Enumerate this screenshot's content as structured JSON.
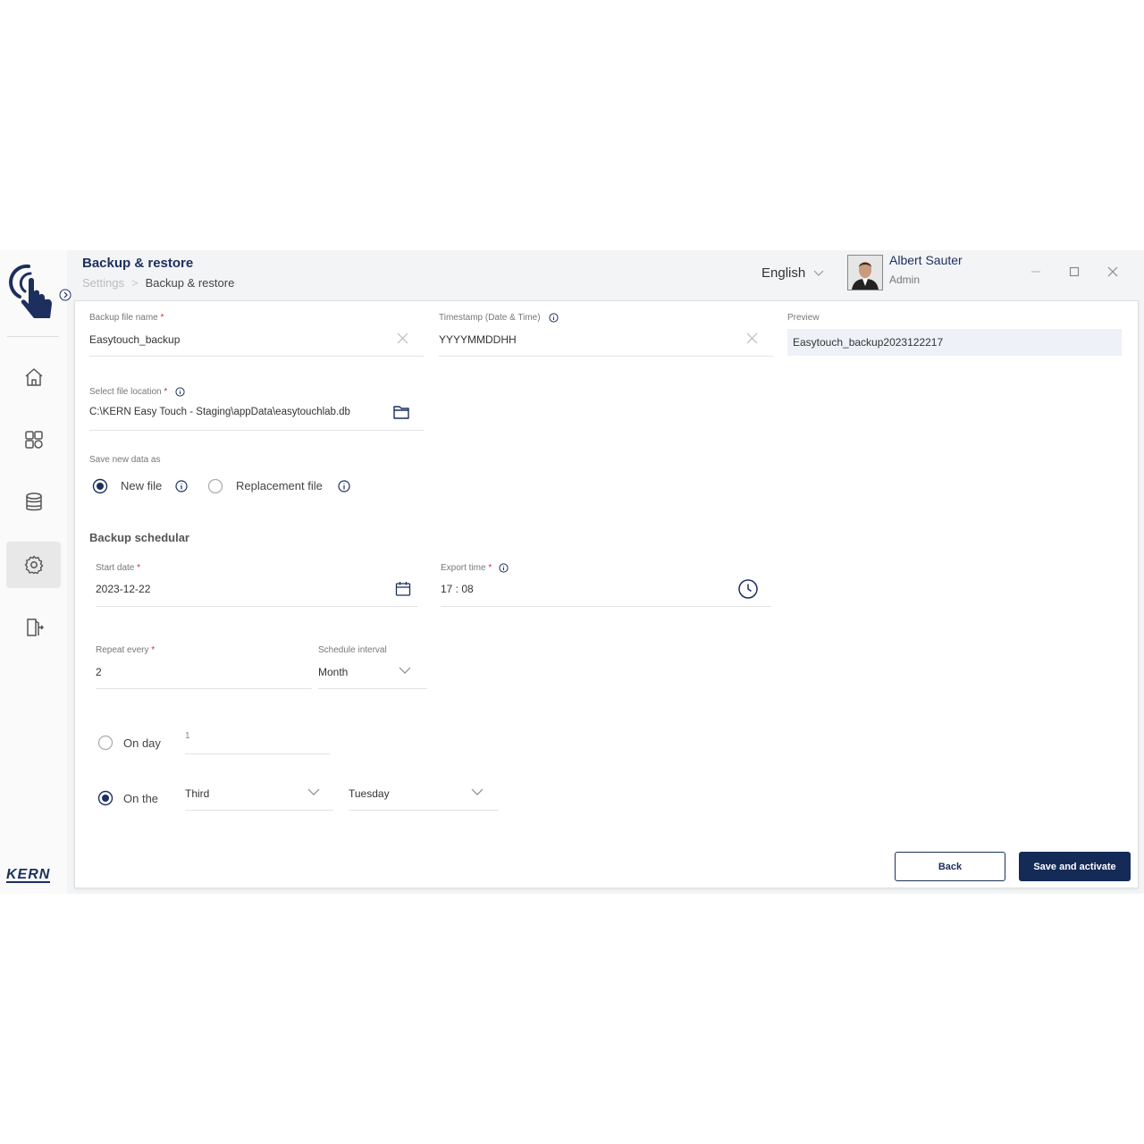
{
  "header": {
    "title": "Backup & restore",
    "breadcrumb": [
      "Settings",
      "Backup & restore"
    ],
    "language": "English",
    "user": {
      "name": "Albert Sauter",
      "role": "Admin"
    }
  },
  "brand": {
    "footer_logo": "KERN",
    "accent": "#1c2f5e"
  },
  "sidebar": {
    "items": [
      {
        "icon": "home-icon",
        "active": false
      },
      {
        "icon": "dashboard-icon",
        "active": false
      },
      {
        "icon": "database-icon",
        "active": false
      },
      {
        "icon": "gear-icon",
        "active": true
      },
      {
        "icon": "logout-icon",
        "active": false
      }
    ]
  },
  "form": {
    "backup_name": {
      "label": "Backup file name",
      "value": "Easytouch_backup"
    },
    "timestamp": {
      "label": "Timestamp (Date & Time)",
      "value": "YYYYMMDDHH"
    },
    "preview": {
      "label": "Preview",
      "value": "Easytouch_backup2023122217"
    },
    "file_location": {
      "label": "Select file location",
      "value": "C:\\KERN Easy Touch - Staging\\appData\\easytouchlab.db"
    },
    "save_as": {
      "label": "Save new data as",
      "options": [
        {
          "label": "New file",
          "selected": true
        },
        {
          "label": "Replacement file",
          "selected": false
        }
      ]
    },
    "scheduler": {
      "title": "Backup schedular",
      "start_date": {
        "label": "Start date",
        "value": "2023-12-22"
      },
      "export_time": {
        "label": "Export time",
        "value": "17 : 08"
      },
      "repeat_every": {
        "label": "Repeat every",
        "value": "2"
      },
      "interval": {
        "label": "Schedule interval",
        "value": "Month"
      },
      "on_day": {
        "label": "On day",
        "value": "1",
        "selected": false
      },
      "on_the": {
        "label": "On the",
        "ordinal": "Third",
        "weekday": "Tuesday",
        "selected": true
      }
    }
  },
  "actions": {
    "back": "Back",
    "save": "Save and activate"
  }
}
